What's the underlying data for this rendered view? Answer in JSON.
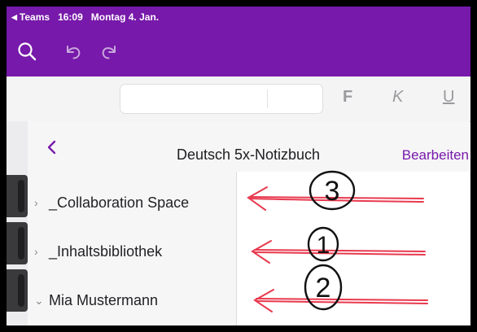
{
  "status_bar": {
    "back_app": "Teams",
    "time": "16:09",
    "date": "Montag 4. Jan."
  },
  "toolbar": {
    "bold": "F",
    "italic": "K",
    "underline": "U"
  },
  "notebook_nav": {
    "title": "Deutsch 5x-Notizbuch",
    "edit_label": "Bearbeiten",
    "sections": [
      {
        "label": "_Collaboration Space",
        "chevron": "›",
        "annotation_number": "3"
      },
      {
        "label": "_Inhaltsbibliothek",
        "chevron": "›",
        "annotation_number": "1"
      },
      {
        "label": "Mia Mustermann",
        "chevron": "⌄",
        "annotation_number": "2"
      }
    ]
  },
  "colors": {
    "brand_purple": "#7719aa",
    "annotation_red": "#e8394e",
    "annotation_ink": "#111111"
  },
  "icons": [
    "search-icon",
    "undo-icon",
    "redo-icon",
    "back-chevron-icon"
  ]
}
